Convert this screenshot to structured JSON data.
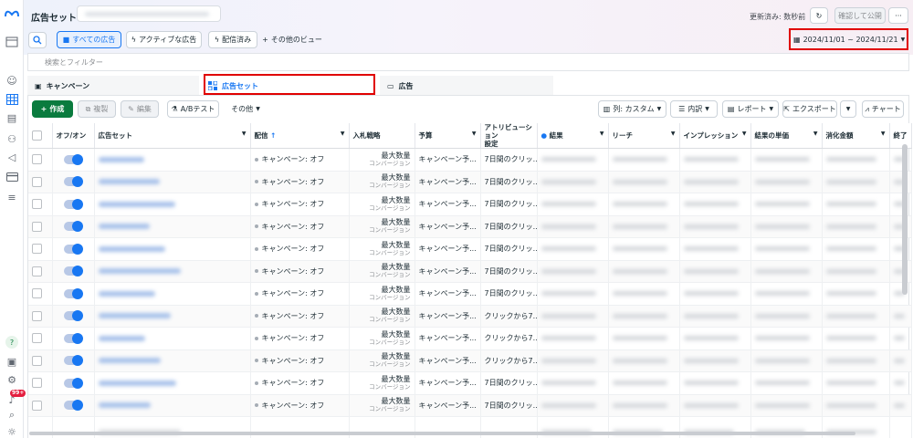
{
  "header": {
    "title": "広告セット",
    "updated": "更新済み: 数秒前",
    "confirm_label": "確認して公開",
    "more_label": "···"
  },
  "view_buttons": {
    "all_ads": "すべての広告",
    "active_ads": "アクティブな広告",
    "delivered": "配信済み",
    "other_views": "その他のビュー"
  },
  "date_range": "2024/11/01 ~ 2024/11/21",
  "filter_placeholder": "検索とフィルター",
  "tabs": [
    "キャンペーン",
    "広告セット",
    "広告"
  ],
  "toolbar": {
    "create": "作成",
    "duplicate": "複製",
    "edit": "編集",
    "abtest": "A/Bテスト",
    "other": "その他",
    "columns": "列: カスタム",
    "breakdown": "内訳",
    "report": "レポート",
    "export": "エクスポート",
    "chart": "チャート"
  },
  "columns": {
    "onoff": "オフ/オン",
    "adset": "広告セット",
    "delivery": "配信",
    "bid": "入札戦略",
    "budget": "予算",
    "attribution_1": "アトリビューション",
    "attribution_2": "設定",
    "results": "結果",
    "reach": "リーチ",
    "impressions": "インプレッション",
    "cost_per_result": "結果の単価",
    "amount_spent": "消化金額",
    "end": "終了"
  },
  "rows": [
    {
      "delivery": "キャンペーン: オフ",
      "bid": "最大数量",
      "bid_sub": "コンバージョン",
      "budget": "キャンペーン予...",
      "attribution": "7日間のクリッ..."
    },
    {
      "delivery": "キャンペーン: オフ",
      "bid": "最大数量",
      "bid_sub": "コンバージョン",
      "budget": "キャンペーン予...",
      "attribution": "7日間のクリッ..."
    },
    {
      "delivery": "キャンペーン: オフ",
      "bid": "最大数量",
      "bid_sub": "コンバージョン",
      "budget": "キャンペーン予...",
      "attribution": "7日間のクリッ..."
    },
    {
      "delivery": "キャンペーン: オフ",
      "bid": "最大数量",
      "bid_sub": "コンバージョン",
      "budget": "キャンペーン予...",
      "attribution": "7日間のクリッ..."
    },
    {
      "delivery": "キャンペーン: オフ",
      "bid": "最大数量",
      "bid_sub": "コンバージョン",
      "budget": "キャンペーン予...",
      "attribution": "7日間のクリッ..."
    },
    {
      "delivery": "キャンペーン: オフ",
      "bid": "最大数量",
      "bid_sub": "コンバージョン",
      "budget": "キャンペーン予...",
      "attribution": "7日間のクリッ..."
    },
    {
      "delivery": "キャンペーン: オフ",
      "bid": "最大数量",
      "bid_sub": "コンバージョン",
      "budget": "キャンペーン予...",
      "attribution": "7日間のクリッ..."
    },
    {
      "delivery": "キャンペーン: オフ",
      "bid": "最大数量",
      "bid_sub": "コンバージョン",
      "budget": "キャンペーン予...",
      "attribution": "クリックから7..."
    },
    {
      "delivery": "キャンペーン: オフ",
      "bid": "最大数量",
      "bid_sub": "コンバージョン",
      "budget": "キャンペーン予...",
      "attribution": "クリックから7..."
    },
    {
      "delivery": "キャンペーン: オフ",
      "bid": "最大数量",
      "bid_sub": "コンバージョン",
      "budget": "キャンペーン予...",
      "attribution": "クリックから7..."
    },
    {
      "delivery": "キャンペーン: オフ",
      "bid": "最大数量",
      "bid_sub": "コンバージョン",
      "budget": "キャンペーン予...",
      "attribution": "7日間のクリッ..."
    },
    {
      "delivery": "キャンペーン: オフ",
      "bid": "最大数量",
      "bid_sub": "コンバージョン",
      "budget": "キャンペーン予...",
      "attribution": "7日間のクリッ..."
    }
  ],
  "footer": {
    "attribution": "—"
  },
  "notifications_badge": "99+",
  "help_icon_label": "?",
  "colors": {
    "accent": "#1877f2",
    "create": "#0a7b3e",
    "highlight": "#e00000"
  }
}
